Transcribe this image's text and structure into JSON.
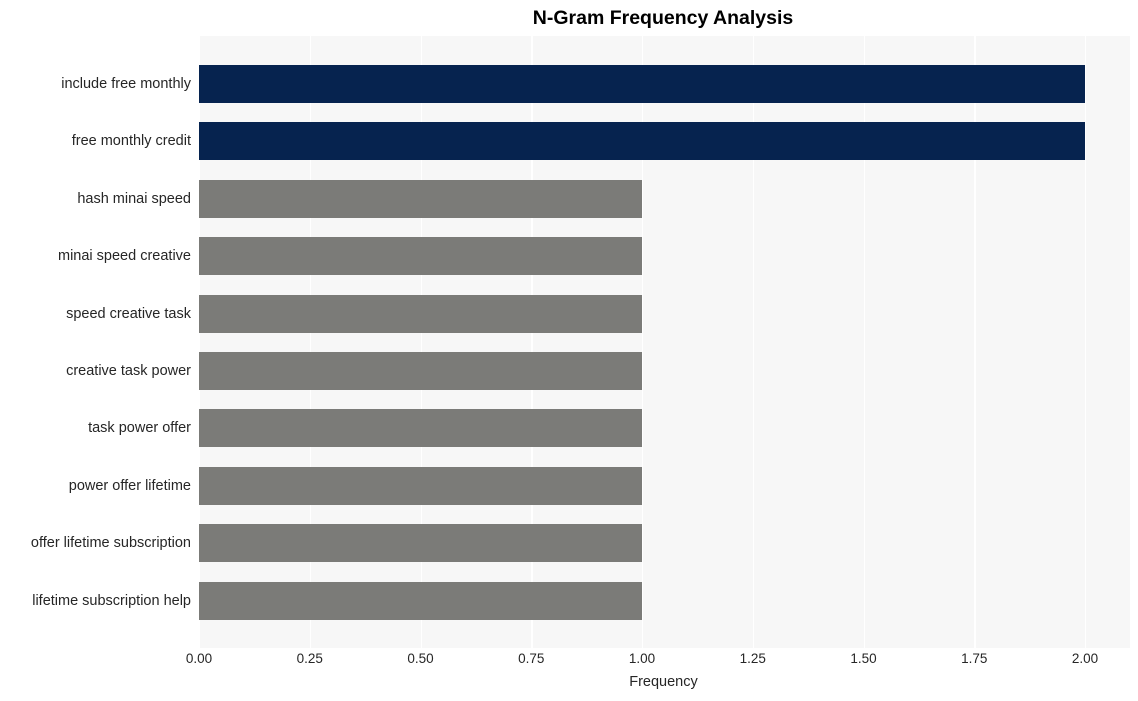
{
  "chart_data": {
    "type": "bar",
    "orientation": "horizontal",
    "title": "N-Gram Frequency Analysis",
    "xlabel": "Frequency",
    "ylabel": "",
    "categories": [
      "include free monthly",
      "free monthly credit",
      "hash minai speed",
      "minai speed creative",
      "speed creative task",
      "creative task power",
      "task power offer",
      "power offer lifetime",
      "offer lifetime subscription",
      "lifetime subscription help"
    ],
    "values": [
      2,
      2,
      1,
      1,
      1,
      1,
      1,
      1,
      1,
      1
    ],
    "bar_colors": [
      "#06234f",
      "#06234f",
      "#7b7b78",
      "#7b7b78",
      "#7b7b78",
      "#7b7b78",
      "#7b7b78",
      "#7b7b78",
      "#7b7b78",
      "#7b7b78"
    ],
    "xlim": [
      0.0,
      2.0
    ],
    "xticks": [
      0.0,
      0.25,
      0.5,
      0.75,
      1.0,
      1.25,
      1.5,
      1.75,
      2.0
    ],
    "xtick_labels": [
      "0.00",
      "0.25",
      "0.50",
      "0.75",
      "1.00",
      "1.25",
      "1.50",
      "1.75",
      "2.00"
    ],
    "grid": true,
    "grid_color": "#ffffff",
    "grid_axis": "x",
    "legend": null,
    "plot_background": "#f7f7f7",
    "figure_background": "#ffffff",
    "highlight_color": "#06234f",
    "default_color": "#7b7b78"
  }
}
